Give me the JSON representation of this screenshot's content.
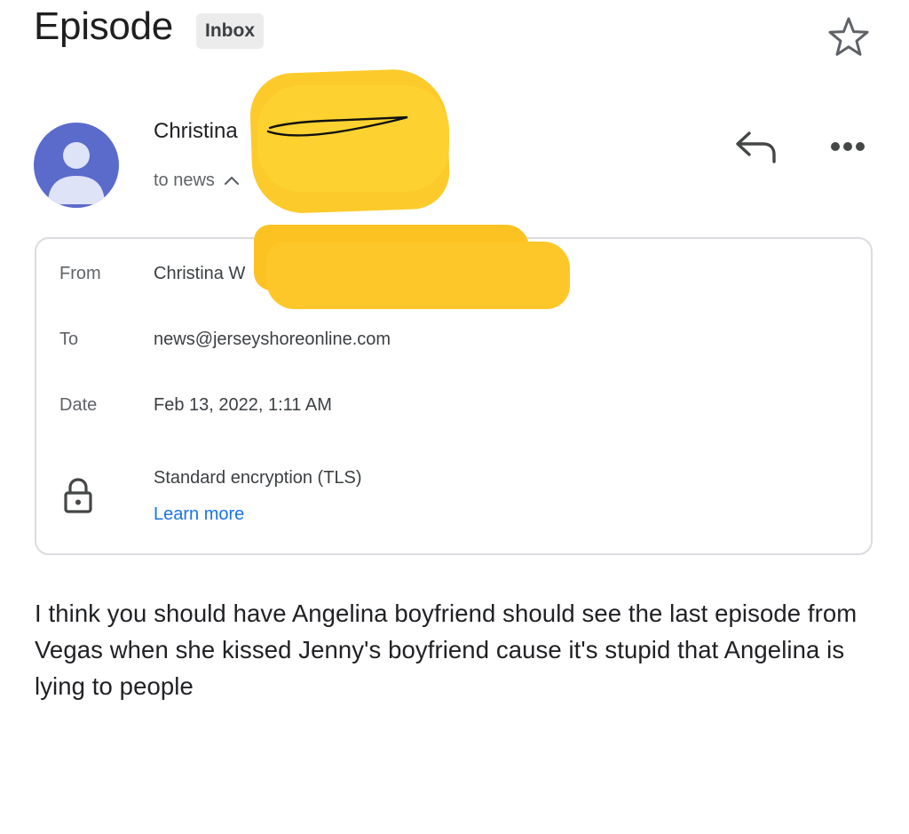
{
  "email": {
    "subject": "Episode",
    "label": "Inbox",
    "sender_name": "Christina",
    "recipient_summary": "to news"
  },
  "details": {
    "from_label": "From",
    "from_value": "Christina W",
    "to_label": "To",
    "to_value": "news@jerseyshoreonline.com",
    "date_label": "Date",
    "date_value": "Feb 13, 2022, 1:11 AM",
    "encryption_text": "Standard encryption (TLS)",
    "learn_more": "Learn more"
  },
  "body": {
    "text": "I think you should have Angelina boyfriend should see the last episode from Vegas when she kissed Jenny's boyfriend cause it's stupid that Angelina is lying to people"
  },
  "icons": {
    "star": "star-outline-icon",
    "reply": "reply-icon",
    "more": "more-horizontal-icon",
    "expand": "chevron-up-icon",
    "lock": "lock-icon",
    "avatar": "person-icon"
  },
  "colors": {
    "avatar_bg": "#5b6bcb",
    "link": "#1a73e8",
    "redaction": "#fccb2b",
    "chip_bg": "#ececec"
  }
}
